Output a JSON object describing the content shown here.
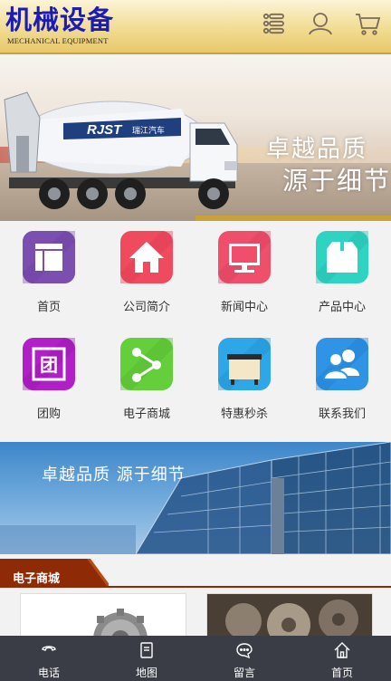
{
  "header": {
    "logo_title": "机械设备",
    "logo_subtitle": "MECHANICAL EQUIPMENT",
    "menu_icon": "list-menu-icon",
    "user_icon": "user-icon",
    "cart_icon": "shopping-cart-icon"
  },
  "banner": {
    "truck_logo_text": "RJST",
    "truck_brand_text": "瑞江汽车",
    "slogan_line1": "卓越品质",
    "slogan_line2": "源于细节"
  },
  "grid": {
    "items": [
      {
        "label": "首页",
        "icon": "home-layout-icon",
        "color": "#7b4fb0"
      },
      {
        "label": "公司简介",
        "icon": "house-icon",
        "color": "#f04a5f"
      },
      {
        "label": "新闻中心",
        "icon": "monitor-icon",
        "color": "#ef4f6b"
      },
      {
        "label": "产品中心",
        "icon": "box-icon",
        "color": "#2fd3c1"
      },
      {
        "label": "团购",
        "icon": "group-buy-icon",
        "color": "#b11fc7"
      },
      {
        "label": "电子商城",
        "icon": "share-icon",
        "color": "#64cf3b"
      },
      {
        "label": "特惠秒杀",
        "icon": "desk-icon",
        "color": "#2ea7e8"
      },
      {
        "label": "联系我们",
        "icon": "contacts-icon",
        "color": "#2f93e6"
      }
    ]
  },
  "solar_banner": {
    "slogan": "卓越品质  源于细节"
  },
  "section": {
    "title": "电子商城"
  },
  "bottom_nav": {
    "items": [
      {
        "label": "电话",
        "icon": "phone-icon"
      },
      {
        "label": "地图",
        "icon": "map-icon"
      },
      {
        "label": "留言",
        "icon": "message-icon"
      },
      {
        "label": "首页",
        "icon": "home-icon"
      }
    ]
  }
}
